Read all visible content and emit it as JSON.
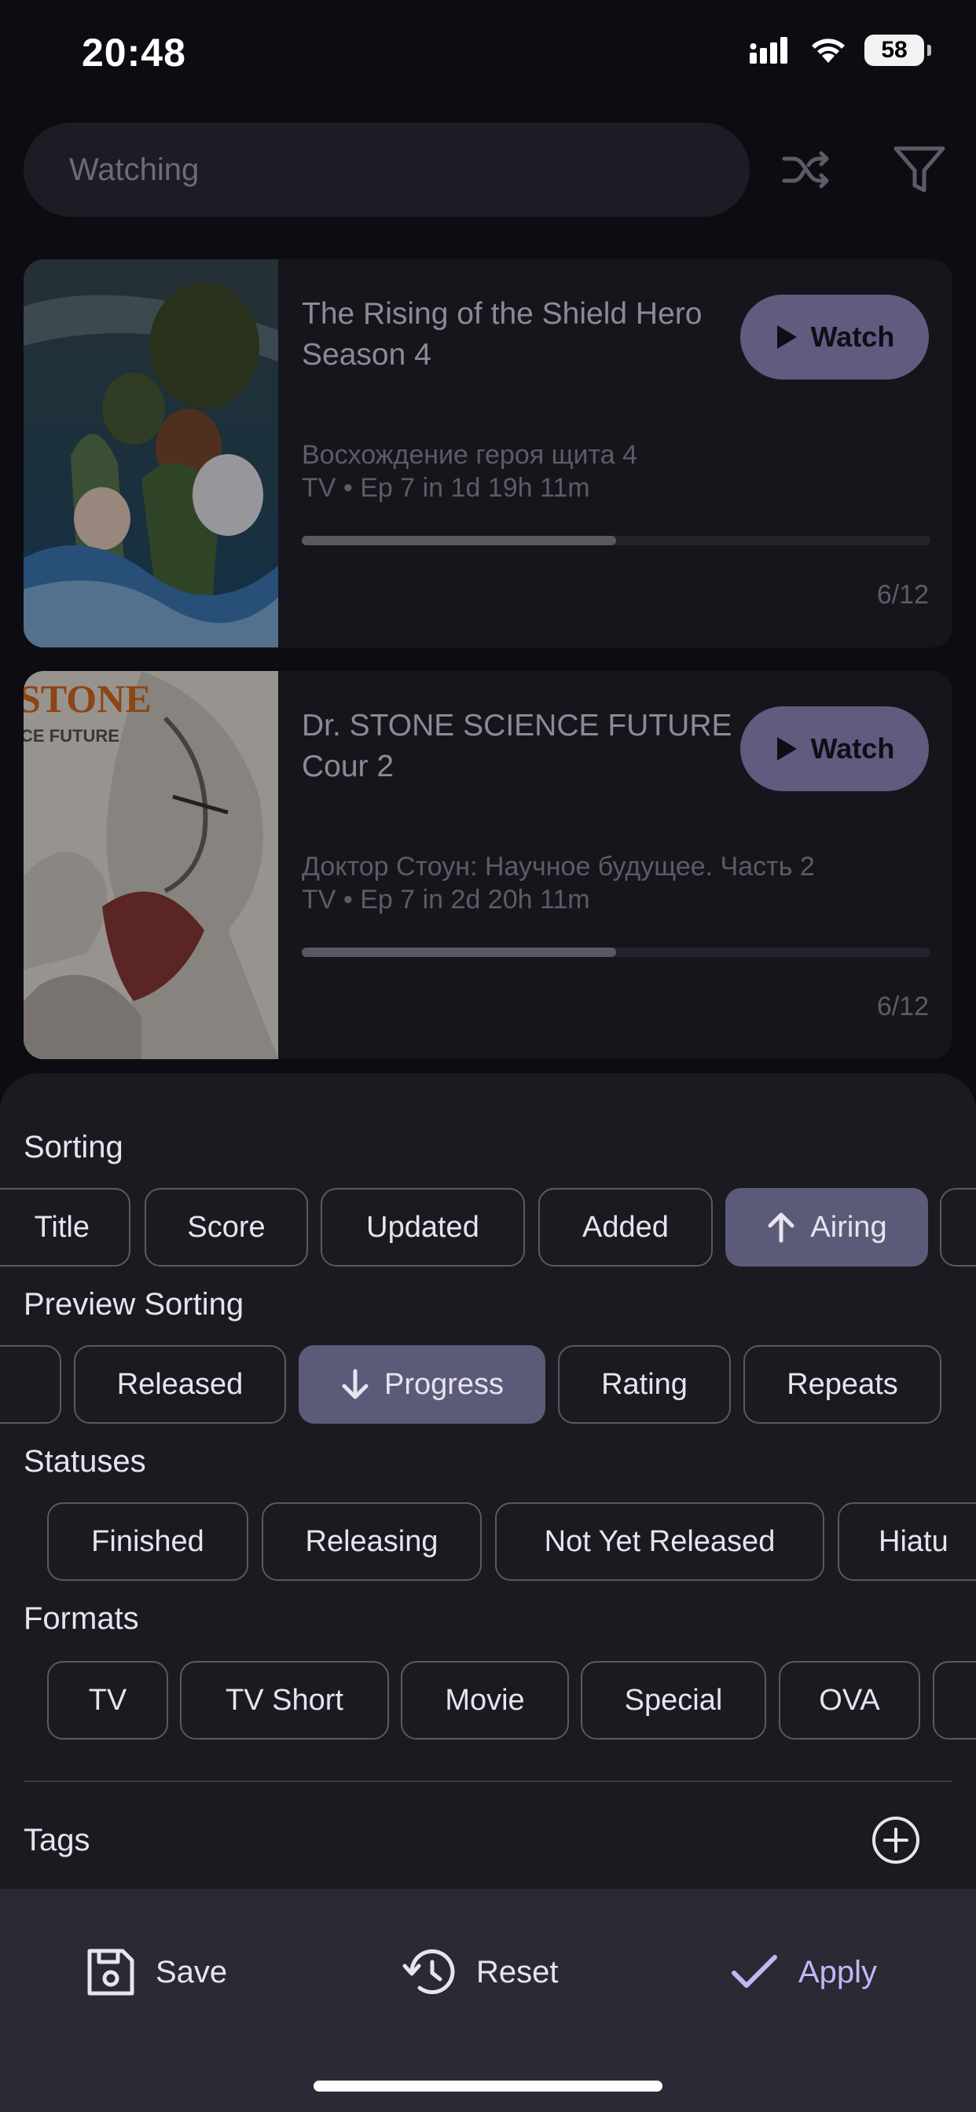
{
  "status_bar": {
    "time": "20:48",
    "battery": "58"
  },
  "toolbar": {
    "search_placeholder": "Watching",
    "shuffle_icon": "shuffle-icon",
    "filter_icon": "filter-icon"
  },
  "cards": [
    {
      "title": "The Rising of the Shield Hero Season 4",
      "alt_title": "Восхождение героя щита 4",
      "info": "TV • Ep 7 in 1d 19h 11m",
      "watch_label": "Watch",
      "progress": 0.5,
      "count": "6/12"
    },
    {
      "title": "Dr. STONE SCIENCE FUTURE Cour 2",
      "alt_title": "Доктор Стоун: Научное будущее. Часть 2",
      "info": "TV • Ep 7 in 2d 20h 11m",
      "watch_label": "Watch",
      "progress": 0.5,
      "count": "6/12",
      "cover_text": "STONE",
      "cover_subtext": "CE FUTURE"
    }
  ],
  "sheet": {
    "sorting": {
      "label": "Sorting",
      "chips": [
        "Title",
        "Score",
        "Updated",
        "Added",
        "Airing"
      ],
      "active": "Airing",
      "active_direction": "up"
    },
    "preview_sorting": {
      "label": "Preview Sorting",
      "chips": [
        "Released",
        "Progress",
        "Rating",
        "Repeats"
      ],
      "active": "Progress",
      "active_direction": "down"
    },
    "statuses": {
      "label": "Statuses",
      "chips": [
        "Finished",
        "Releasing",
        "Not Yet Released",
        "Hiatu"
      ]
    },
    "formats": {
      "label": "Formats",
      "chips": [
        "TV",
        "TV Short",
        "Movie",
        "Special",
        "OVA"
      ]
    },
    "tags": {
      "label": "Tags"
    },
    "actions": {
      "save": "Save",
      "reset": "Reset",
      "apply": "Apply"
    },
    "accent_color": "#bfb8f5",
    "active_chip_color": "#5b5a78"
  }
}
